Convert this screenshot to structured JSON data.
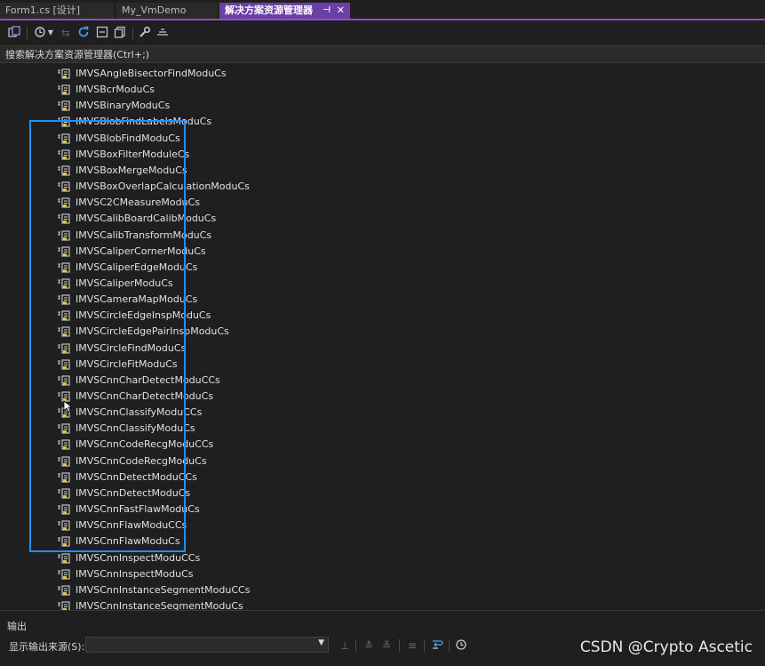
{
  "tabs": [
    {
      "label": "Form1.cs [设计]"
    },
    {
      "label": "My_VmDemo"
    },
    {
      "label": "解决方案资源管理器",
      "pin": "⊣",
      "close": "✕"
    }
  ],
  "toolbar": {
    "icons": [
      "switch-views-icon",
      "history-icon",
      "dropdown-icon",
      "back-icon",
      "refresh-icon",
      "collapse-all-icon",
      "show-all-files-icon",
      "properties-wrench-icon",
      "preview-icon"
    ]
  },
  "search": {
    "placeholder": "搜索解决方案资源管理器(Ctrl+;)"
  },
  "tree": {
    "items": [
      "IMVSAngleBisectorFindModuCs",
      "IMVSBcrModuCs",
      "IMVSBinaryModuCs",
      "IMVSBlobFindLabelsModuCs",
      "IMVSBlobFindModuCs",
      "IMVSBoxFilterModuleCs",
      "IMVSBoxMergeModuCs",
      "IMVSBoxOverlapCalculationModuCs",
      "IMVSC2CMeasureModuCs",
      "IMVSCalibBoardCalibModuCs",
      "IMVSCalibTransformModuCs",
      "IMVSCaliperCornerModuCs",
      "IMVSCaliperEdgeModuCs",
      "IMVSCaliperModuCs",
      "IMVSCameraMapModuCs",
      "IMVSCircleEdgeInspModuCs",
      "IMVSCircleEdgePairInspModuCs",
      "IMVSCircleFindModuCs",
      "IMVSCircleFitModuCs",
      "IMVSCnnCharDetectModuCCs",
      "IMVSCnnCharDetectModuCs",
      "IMVSCnnClassifyModuCCs",
      "IMVSCnnClassifyModuCs",
      "IMVSCnnCodeRecgModuCCs",
      "IMVSCnnCodeRecgModuCs",
      "IMVSCnnDetectModuCCs",
      "IMVSCnnDetectModuCs",
      "IMVSCnnFastFlawModuCs",
      "IMVSCnnFlawModuCCs",
      "IMVSCnnFlawModuCs",
      "IMVSCnnInspectModuCCs",
      "IMVSCnnInspectModuCs",
      "IMVSCnnInstanceSegmentModuCCs",
      "IMVSCnnInstanceSegmentModuCs"
    ],
    "item_icon": "reference-icon"
  },
  "output": {
    "title": "输出",
    "source_label": "显示输出来源(S):",
    "source_value": "",
    "dropdown_arrow": "▼"
  },
  "watermark": "CSDN @Crypto Ascetic",
  "colors": {
    "active_tab": "#6b3fa8",
    "highlight_box": "#1e90ff",
    "background": "#1f1f1f"
  }
}
